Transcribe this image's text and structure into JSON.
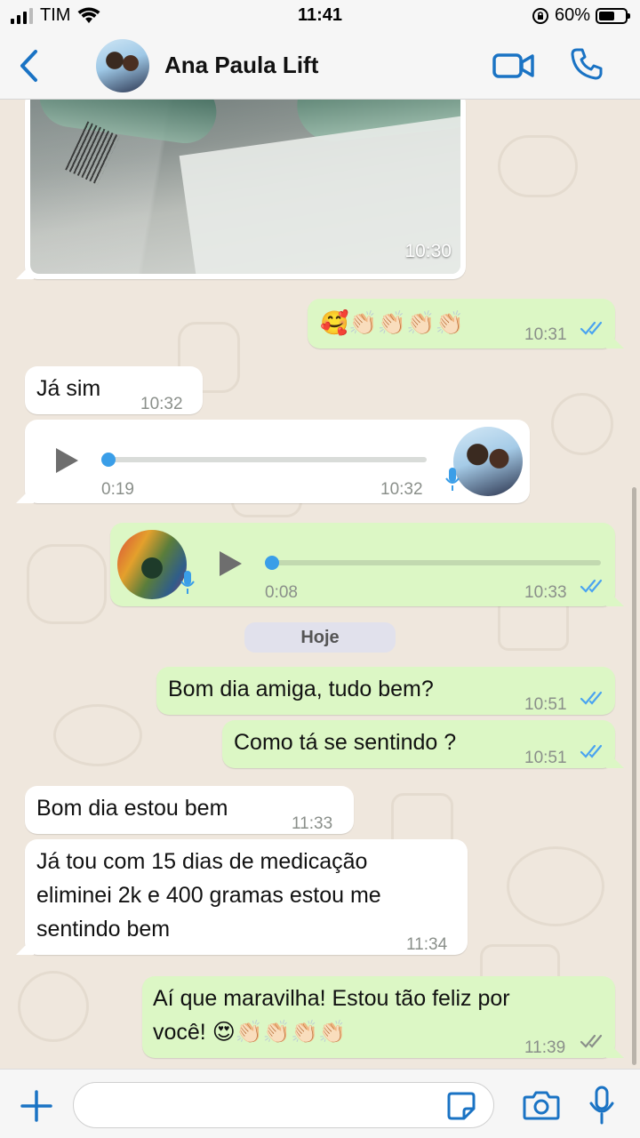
{
  "status_bar": {
    "carrier": "TIM",
    "time": "11:41",
    "battery_percent": "60%",
    "battery_level": 0.6
  },
  "header": {
    "contact_name": "Ana Paula Lift",
    "back_icon": "chevron-left-icon",
    "video_icon": "video-call-icon",
    "call_icon": "phone-icon"
  },
  "messages": {
    "photo": {
      "time": "10:30"
    },
    "emoji_reaction": {
      "emojis": "🥰👏🏻👏🏻👏🏻👏🏻",
      "time": "10:31"
    },
    "ja_sim": {
      "text": "Já sim",
      "time": "10:32"
    },
    "voice_in": {
      "duration": "0:19",
      "time": "10:32"
    },
    "voice_out": {
      "duration": "0:08",
      "time": "10:33"
    },
    "date_separator": "Hoje",
    "bom_dia": {
      "text": "Bom dia amiga, tudo bem?",
      "time": "10:51"
    },
    "como_ta": {
      "text": "Como tá se sentindo ?",
      "time": "10:51"
    },
    "reply_bem": {
      "text": "Bom dia estou bem",
      "time": "11:33"
    },
    "reply_long": {
      "line1": "Já tou com 15 dias de medicação",
      "line2": "eliminei 2k e 400 gramas estou me",
      "line3": "sentindo bem",
      "time": "11:34"
    },
    "final": {
      "line1": "Aí que maravilha! Estou tão feliz por",
      "line2": "você! 😍👏🏻👏🏻👏🏻👏🏻",
      "time": "11:39"
    }
  },
  "input_bar": {
    "placeholder": "",
    "plus_icon": "plus-icon",
    "sticker_icon": "sticker-icon",
    "camera_icon": "camera-icon",
    "mic_icon": "microphone-icon"
  },
  "colors": {
    "accent": "#1a73c4",
    "incoming_bubble": "#ffffff",
    "outgoing_bubble": "#dcf7c5",
    "read_ticks": "#4aa3f0",
    "chat_background": "#efe7dd"
  }
}
